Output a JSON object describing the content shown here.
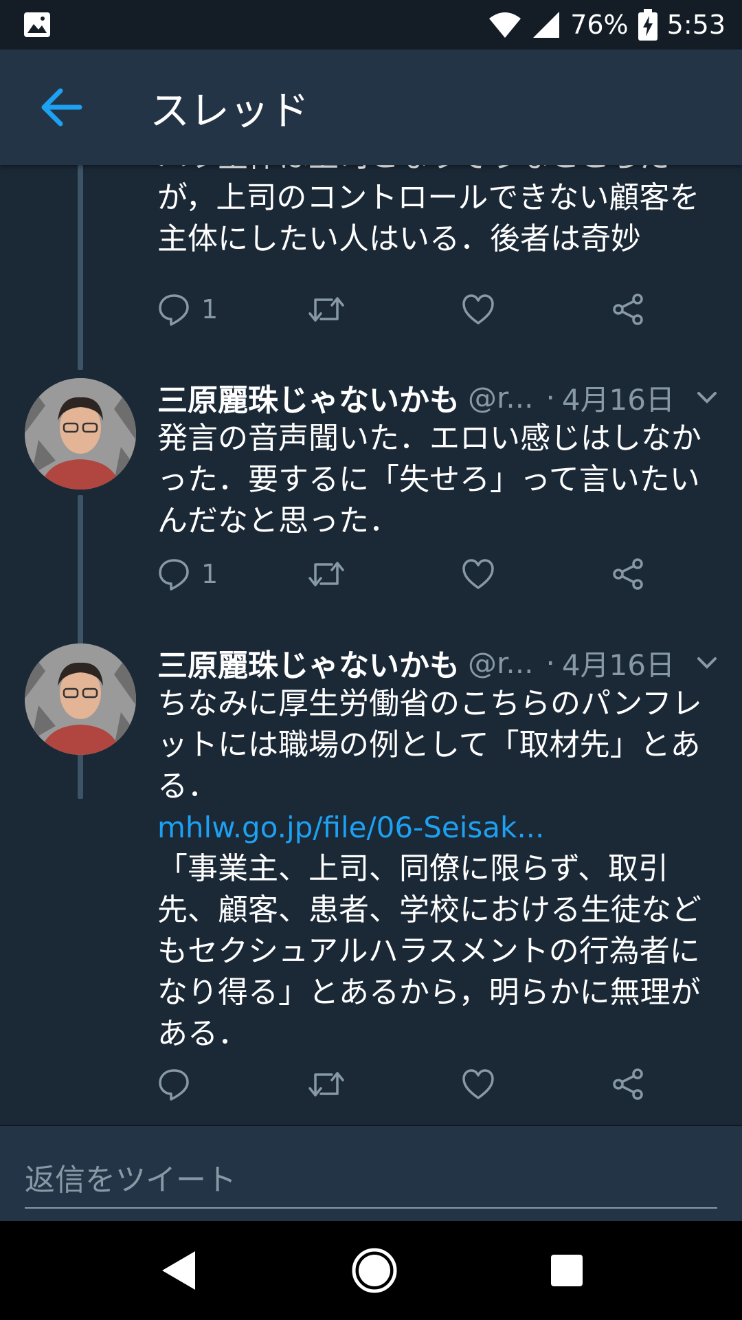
{
  "status_bar": {
    "battery": "76%",
    "time": "5:53",
    "icons": [
      "image-icon",
      "wifi-icon",
      "signal-icon",
      "battery-charging-icon"
    ]
  },
  "app_bar": {
    "title": "スレッド",
    "back_icon": "arrow-left-icon",
    "accent": "#1da1f2"
  },
  "tweets": [
    {
      "text_lines": [
        "ハラ主体は上司となりそうなところだ",
        "が，上司のコントロールできない顧客を",
        "主体にしたい人はいる．後者は奇妙"
      ],
      "reply_count": "1"
    },
    {
      "name": "三原麗珠じゃないかも",
      "handle": "@r...",
      "separator": "·",
      "date": "4月16日",
      "text_lines": [
        "発言の音声聞いた．エロい感じはしなか",
        "った．要するに「失せろ」って言いたい",
        "んだなと思った．"
      ],
      "reply_count": "1"
    },
    {
      "name": "三原麗珠じゃないかも",
      "handle": "@r...",
      "separator": "·",
      "date": "4月16日",
      "text_lines_a": [
        "ちなみに厚生労働省のこちらのパンフレ",
        "ットには職場の例として「取材先」とあ",
        "る．"
      ],
      "link": "mhlw.go.jp/file/06-Seisak...",
      "text_lines_b": [
        "「事業主、上司、同僚に限らず、取引",
        "先、顧客、患者、学校における生徒など",
        "もセクシュアルハラスメントの行為者に",
        "なり得る」とあるから，明らかに無理が",
        "ある．"
      ],
      "reply_count": ""
    }
  ],
  "reply_bar": {
    "placeholder": "返信をツイート"
  },
  "colors": {
    "background": "#1b2836",
    "header": "#243447",
    "secondary_text": "#8899a6",
    "link": "#1da1f2"
  }
}
